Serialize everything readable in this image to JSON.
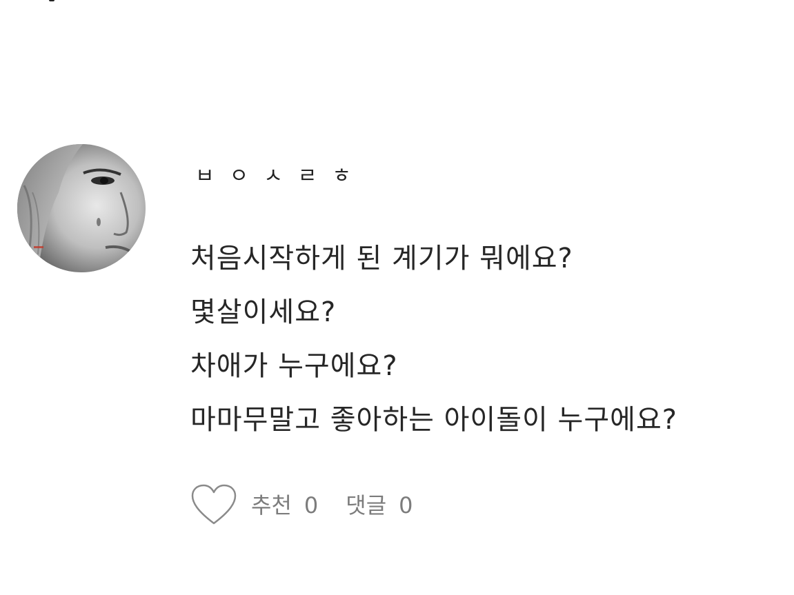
{
  "post": {
    "author": {
      "name": "ㅂㅇㅅㄹㅎ"
    },
    "lines": [
      "처음시작하게 된 계기가 뭐에요?",
      "몇살이세요?",
      "차애가 누구에요?",
      "마마무말고 좋아하는 아이돌이 누구에요?"
    ],
    "actions": {
      "like_label": "추천",
      "like_count": "0",
      "comment_label": "댓글",
      "comment_count": "0"
    }
  },
  "colors": {
    "text": "#262626",
    "muted": "#7c7c7c",
    "background": "#ffffff"
  }
}
